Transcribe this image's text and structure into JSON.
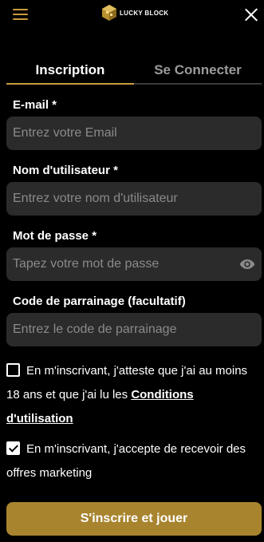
{
  "header": {
    "menu_icon": "hamburger-icon",
    "logo_text": "LUCKY BLOCK",
    "close_icon": "close-icon"
  },
  "colors": {
    "accent": "#c89b3c",
    "button": "#a8842f",
    "field_bg": "#2b2b2b",
    "background": "#000000"
  },
  "tabs": [
    {
      "label": "Inscription",
      "active": true
    },
    {
      "label": "Se Connecter",
      "active": false
    }
  ],
  "form": {
    "email": {
      "label": "E-mail *",
      "placeholder": "Entrez votre Email",
      "value": ""
    },
    "username": {
      "label": "Nom d'utilisateur *",
      "placeholder": "Entrez votre nom d'utilisateur",
      "value": ""
    },
    "password": {
      "label": "Mot de passe *",
      "placeholder": "Tapez votre mot de passe",
      "value": "",
      "icon": "eye-icon"
    },
    "referral": {
      "label": "Code de parrainage (facultatif)",
      "placeholder": "Entrez le code de parrainage",
      "value": ""
    },
    "terms": {
      "checked": false,
      "text": "En m'inscrivant, j'atteste que j'ai au moins 18 ans et que j'ai lu les ",
      "link": "Conditions d'utilisation"
    },
    "marketing": {
      "checked": true,
      "text": "En m'inscrivant, j'accepte de recevoir des offres marketing"
    },
    "submit_label": "S'inscrire et jouer"
  }
}
